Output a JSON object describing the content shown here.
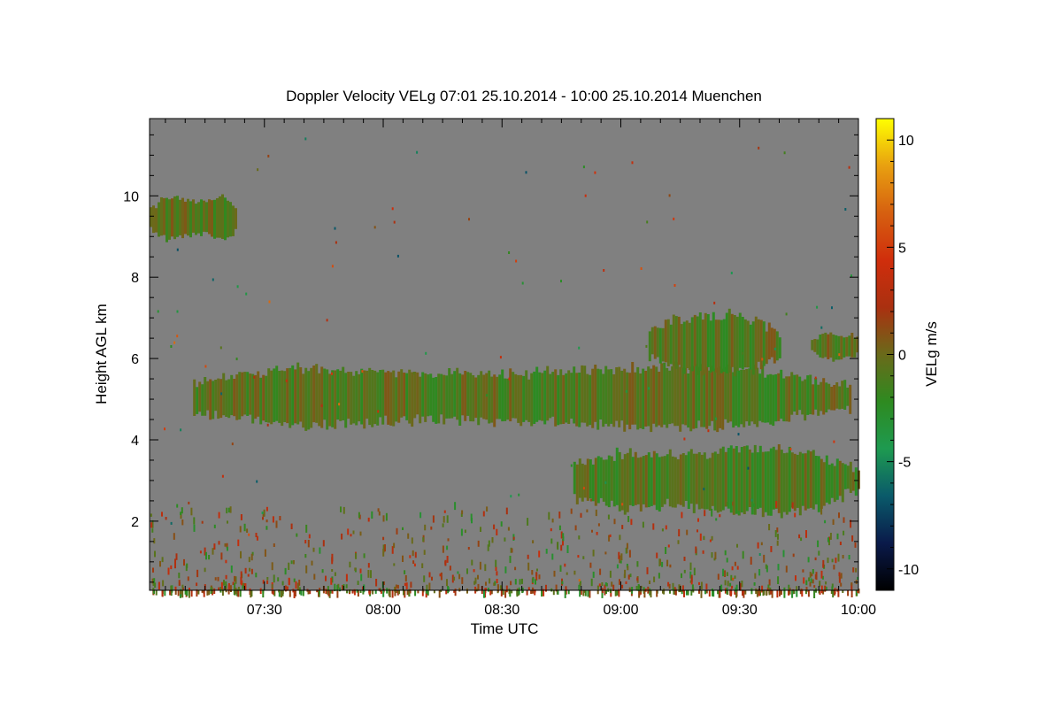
{
  "chart_data": {
    "type": "heatmap",
    "title": "Doppler Velocity VELg   07:01 25.10.2014 - 10:00 25.10.2014 Muenchen",
    "xlabel": "Time UTC",
    "ylabel": "Height AGL km",
    "x_range": [
      "07:01",
      "10:00"
    ],
    "x_ticks": [
      "07:30",
      "08:00",
      "08:30",
      "09:00",
      "09:30",
      "10:00"
    ],
    "ylim": [
      0.3,
      11.9
    ],
    "y_ticks": [
      "2",
      "4",
      "6",
      "8",
      "10"
    ],
    "colorbar": {
      "label": "VELg m/s",
      "range": [
        -11,
        11
      ],
      "ticks": [
        "10",
        "5",
        "0",
        "-5",
        "-10"
      ],
      "colors": [
        "#000000",
        "#0a1a4a",
        "#0a5a6a",
        "#1e9a50",
        "#2e8a20",
        "#6a6a1a",
        "#aa3010",
        "#d02e0c",
        "#d66010",
        "#e8a010",
        "#ffff00"
      ]
    },
    "background_color": "#808080",
    "cloud_layers": [
      {
        "start": "07:01",
        "end": "07:23",
        "bottom_km": 9.0,
        "top_km": 9.9,
        "mean_velocity": -0.5
      },
      {
        "start": "07:12",
        "end": "09:58",
        "bottom_km": 4.4,
        "top_km": 5.7,
        "mean_velocity": -0.8
      },
      {
        "start": "08:48",
        "end": "10:00",
        "bottom_km": 2.3,
        "top_km": 3.7,
        "mean_velocity": -1.0
      },
      {
        "start": "09:07",
        "end": "09:40",
        "bottom_km": 5.7,
        "top_km": 7.0,
        "mean_velocity": -0.8
      },
      {
        "start": "09:48",
        "end": "10:00",
        "bottom_km": 6.0,
        "top_km": 6.6,
        "mean_velocity": -0.5
      }
    ]
  }
}
